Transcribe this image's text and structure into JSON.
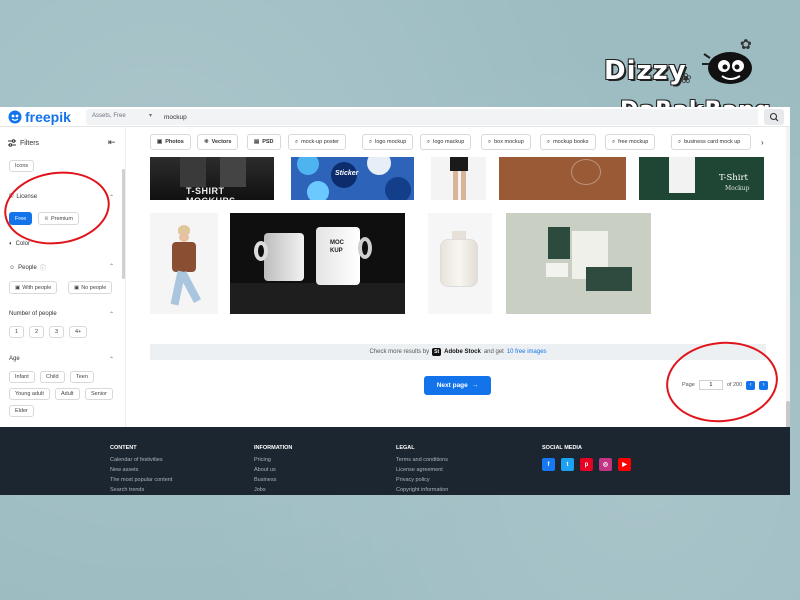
{
  "brand": {
    "line1": "Dizzy",
    "line2": "DaRakBang"
  },
  "topbar": {
    "logo_text": "freepik",
    "filter_select": "Assets, Free",
    "search_value": "mockup"
  },
  "sidebar": {
    "header": "Filters",
    "icons_chip": "Icons",
    "license": {
      "label": "License",
      "free": "Free",
      "premium": "Premium"
    },
    "color_label": "Color",
    "people": {
      "label": "People",
      "with": "With people",
      "without": "No people"
    },
    "number_of_people": {
      "label": "Number of people",
      "options": [
        "1",
        "2",
        "3",
        "4+"
      ]
    },
    "age": {
      "label": "Age",
      "options": [
        "Infant",
        "Child",
        "Teen",
        "Young adult",
        "Adult",
        "Senior",
        "Elder"
      ]
    }
  },
  "toolbar": {
    "type_pills": [
      "Photos",
      "Vectors",
      "PSD"
    ],
    "related_tags": [
      "mock-up poster",
      "logo mockup",
      "logo mackup",
      "box mockup",
      "mockup books",
      "free mockup",
      "business card mock up"
    ]
  },
  "thumbnails": {
    "tshirt_mockups_label": "T-SHIRT MOCKUPS",
    "sticker_text": "Sticker",
    "tshirt_mockup_label": "T-Shirt",
    "tshirt_mockup_sub": "Mockup",
    "mug_text": "MOCKUP"
  },
  "stock_bar": {
    "prefix": "Check more results by",
    "brand": "Adobe Stock",
    "middle": "and get",
    "link": "10 free images"
  },
  "pagination": {
    "next_label": "Next page",
    "page_label": "Page",
    "current_page": "1",
    "total_label": "of 200"
  },
  "footer": {
    "columns": [
      {
        "title": "CONTENT",
        "links": [
          "Calendar of festivities",
          "New assets",
          "The most popular content",
          "Search trends"
        ]
      },
      {
        "title": "INFORMATION",
        "links": [
          "Pricing",
          "About us",
          "Business",
          "Jobs"
        ]
      },
      {
        "title": "LEGAL",
        "links": [
          "Terms and conditions",
          "License agreement",
          "Privacy policy",
          "Copyright information"
        ]
      }
    ],
    "social_title": "SOCIAL MEDIA"
  },
  "colors": {
    "accent": "#1273eb",
    "footer_bg": "#1c2630",
    "annotation": "#e0151b",
    "facebook": "#1877f2",
    "twitter": "#1da1f2",
    "pinterest": "#e60023",
    "instagram": "#c13584",
    "youtube": "#ff0000"
  }
}
